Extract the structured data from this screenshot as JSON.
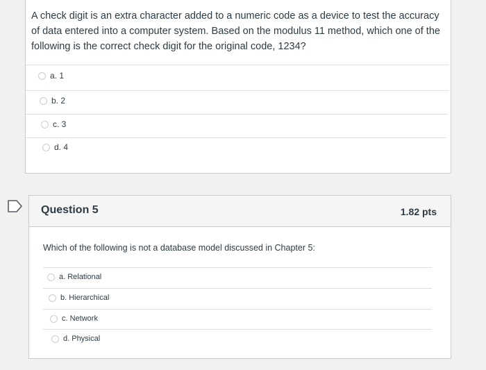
{
  "question4": {
    "text": "A check digit is an extra character added to a numeric code as a device to test the accuracy of data entered into a computer system. Based on the modulus 11 method, which one of the following is the correct check digit for the original code, 1234?",
    "options": [
      "a. 1",
      "b. 2",
      "c. 3",
      "d. 4"
    ]
  },
  "question5": {
    "title": "Question 5",
    "points": "1.82 pts",
    "text": "Which of the following is not a database model discussed in Chapter 5:",
    "options": [
      "a. Relational",
      "b. Hierarchical",
      "c. Network",
      "d. Physical"
    ]
  }
}
